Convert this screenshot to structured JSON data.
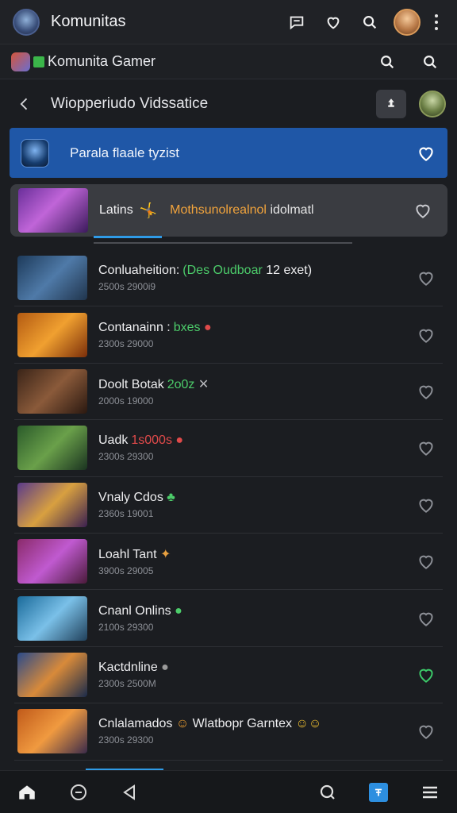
{
  "topbar": {
    "title": "Komunitas"
  },
  "subbar": {
    "title": "Komunita Gamer"
  },
  "header": {
    "title": "Wiopperiudo Vidssatice"
  },
  "banner": {
    "text": "Parala flaale tyzist"
  },
  "featured": {
    "label": "Latins",
    "orange_text": "Mothsunolrealnol",
    "white_text": "idolmatl",
    "emoji1": "🤸",
    "emoji2": "⚠"
  },
  "list": [
    {
      "name": "Conluaheition:",
      "accent": "(Des Oudboar",
      "accent2": "12 exet)",
      "meta": "2500s 2900i9",
      "accent_color": "#4ccc6a",
      "liked": false
    },
    {
      "name": "Contanainn :",
      "accent": "bxes",
      "accent2": "",
      "meta": "2300s 29000",
      "accent_color": "#4ccc6a",
      "liked": false
    },
    {
      "name": "Doolt Botak",
      "accent": "2o0z",
      "accent2": "",
      "meta": "2000s 19000",
      "accent_color": "#4ccc6a",
      "liked": false
    },
    {
      "name": "Uadk",
      "accent": "1s000s",
      "accent2": "",
      "meta": "2300s 29300",
      "accent_color": "#e04a4a",
      "liked": false
    },
    {
      "name": "Vnaly Cdos",
      "accent": "",
      "accent2": "",
      "meta": "2360s 19001",
      "accent_color": "#4ccc6a",
      "liked": false
    },
    {
      "name": "Loahl Tant",
      "accent": "",
      "accent2": "",
      "meta": "3900s 29005",
      "accent_color": "#e8a040",
      "liked": false
    },
    {
      "name": "Cnanl Onlins",
      "accent": "",
      "accent2": "",
      "meta": "2100s 29300",
      "accent_color": "#4ccc6a",
      "liked": false
    },
    {
      "name": "Kactdnline",
      "accent": "",
      "accent2": "",
      "meta": "2300s 2500M",
      "accent_color": "#9a9a9a",
      "liked": true
    },
    {
      "name": "Cnlalamados",
      "accent": "Wlatbopr Garntex",
      "accent2": "",
      "meta": "2300s 29300",
      "accent_color": "#ffffff",
      "liked": false
    }
  ],
  "colors": {
    "background": "#1b1d21",
    "banner": "#1f57a7",
    "accent_blue": "#2f9be7",
    "liked_green": "#3ccc6a"
  }
}
